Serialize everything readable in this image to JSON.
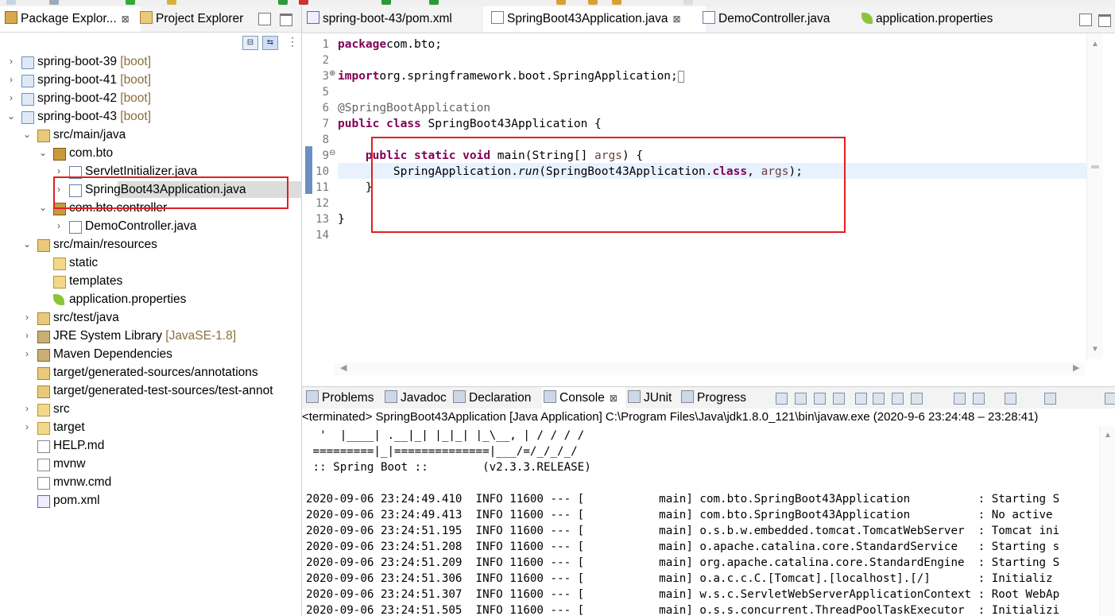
{
  "left_tabs": [
    {
      "label": "Package Explor...",
      "close": "⊠",
      "active": true
    },
    {
      "label": "Project Explorer",
      "active": false
    }
  ],
  "tree": [
    {
      "label": "spring-boot-39",
      "decoration": "[boot]",
      "icon": "maven-project-icon",
      "level": 0,
      "expand": "closed"
    },
    {
      "label": "spring-boot-41",
      "decoration": "[boot]",
      "icon": "maven-project-icon",
      "level": 0,
      "expand": "closed"
    },
    {
      "label": "spring-boot-42",
      "decoration": "[boot]",
      "icon": "maven-project-icon",
      "level": 0,
      "expand": "closed"
    },
    {
      "label": "spring-boot-43",
      "decoration": "[boot]",
      "icon": "maven-project-icon",
      "level": 0,
      "expand": "open"
    },
    {
      "label": "src/main/java",
      "decoration": "",
      "icon": "source-folder-icon",
      "level": 1,
      "expand": "open"
    },
    {
      "label": "com.bto",
      "decoration": "",
      "icon": "package-icon",
      "level": 2,
      "expand": "open"
    },
    {
      "label": "ServletInitializer.java",
      "decoration": "",
      "icon": "java-file-icon",
      "level": 3,
      "expand": "closed"
    },
    {
      "label": "SpringBoot43Application.java",
      "decoration": "",
      "icon": "java-file-icon",
      "level": 3,
      "expand": "closed",
      "selected": true
    },
    {
      "label": "com.bto.controller",
      "decoration": "",
      "icon": "package-icon",
      "level": 2,
      "expand": "open"
    },
    {
      "label": "DemoController.java",
      "decoration": "",
      "icon": "java-file-icon",
      "level": 3,
      "expand": "closed"
    },
    {
      "label": "src/main/resources",
      "decoration": "",
      "icon": "source-folder-icon",
      "level": 1,
      "expand": "open"
    },
    {
      "label": "static",
      "decoration": "",
      "icon": "folder-icon",
      "level": 2,
      "expand": "none"
    },
    {
      "label": "templates",
      "decoration": "",
      "icon": "folder-icon",
      "level": 2,
      "expand": "none"
    },
    {
      "label": "application.properties",
      "decoration": "",
      "icon": "properties-file-icon",
      "level": 2,
      "expand": "none"
    },
    {
      "label": "src/test/java",
      "decoration": "",
      "icon": "source-folder-icon",
      "level": 1,
      "expand": "closed"
    },
    {
      "label": "JRE System Library",
      "decoration": "[JavaSE-1.8]",
      "icon": "library-icon",
      "level": 1,
      "expand": "closed"
    },
    {
      "label": "Maven Dependencies",
      "decoration": "",
      "icon": "library-icon",
      "level": 1,
      "expand": "closed"
    },
    {
      "label": "target/generated-sources/annotations",
      "decoration": "",
      "icon": "source-folder-icon",
      "level": 1,
      "expand": "none"
    },
    {
      "label": "target/generated-test-sources/test-annot",
      "decoration": "",
      "icon": "source-folder-icon",
      "level": 1,
      "expand": "none"
    },
    {
      "label": "src",
      "decoration": "",
      "icon": "folder-icon",
      "level": 1,
      "expand": "closed"
    },
    {
      "label": "target",
      "decoration": "",
      "icon": "folder-icon",
      "level": 1,
      "expand": "closed"
    },
    {
      "label": "HELP.md",
      "decoration": "",
      "icon": "file-icon",
      "level": 1,
      "expand": "none"
    },
    {
      "label": "mvnw",
      "decoration": "",
      "icon": "file-icon",
      "level": 1,
      "expand": "none"
    },
    {
      "label": "mvnw.cmd",
      "decoration": "",
      "icon": "file-icon",
      "level": 1,
      "expand": "none"
    },
    {
      "label": "pom.xml",
      "decoration": "",
      "icon": "maven-file-icon",
      "level": 1,
      "expand": "none"
    }
  ],
  "editor_tabs": [
    {
      "label": "spring-boot-43/pom.xml",
      "icon": "maven-file-icon",
      "active": false,
      "close": ""
    },
    {
      "label": "SpringBoot43Application.java",
      "icon": "java-file-icon",
      "active": true,
      "close": "⊠"
    },
    {
      "label": "DemoController.java",
      "icon": "java-file-icon",
      "active": false,
      "close": ""
    },
    {
      "label": "application.properties",
      "icon": "properties-file-icon",
      "active": false,
      "close": ""
    }
  ],
  "code": [
    {
      "n": "1",
      "tokens": [
        [
          "kw",
          "package"
        ],
        [
          "",
          "com.bto;"
        ]
      ]
    },
    {
      "n": "2",
      "tokens": []
    },
    {
      "n": "3",
      "fold": "⊕",
      "tokens": [
        [
          "kw",
          "import"
        ],
        [
          "",
          "org.springframework.boot.SpringApplication;"
        ],
        [
          "box",
          "□"
        ]
      ]
    },
    {
      "n": "5",
      "tokens": []
    },
    {
      "n": "6",
      "tokens": [
        [
          "ann",
          "@SpringBootApplication"
        ]
      ]
    },
    {
      "n": "7",
      "tokens": [
        [
          "kw",
          "public"
        ],
        [
          "kw",
          " class"
        ],
        [
          "",
          " SpringBoot43Application {"
        ]
      ]
    },
    {
      "n": "8",
      "tokens": []
    },
    {
      "n": "9",
      "fold": "⊖",
      "tokens": [
        [
          "",
          "    "
        ],
        [
          "kw",
          "public"
        ],
        [
          "kw",
          " static"
        ],
        [
          "kw",
          " void"
        ],
        [
          "",
          " main(String[] "
        ],
        [
          "param",
          "args"
        ],
        [
          "",
          ") {"
        ]
      ]
    },
    {
      "n": "10",
      "current": true,
      "tokens": [
        [
          "",
          "        SpringApplication."
        ],
        [
          "it",
          "run"
        ],
        [
          "",
          "(SpringBoot43Application."
        ],
        [
          "kw",
          "class"
        ],
        [
          "",
          ", "
        ],
        [
          "param",
          "args"
        ],
        [
          "",
          ");"
        ]
      ]
    },
    {
      "n": "11",
      "tokens": [
        [
          "",
          "    }"
        ]
      ]
    },
    {
      "n": "12",
      "tokens": []
    },
    {
      "n": "13",
      "tokens": [
        [
          "",
          "}"
        ]
      ]
    },
    {
      "n": "14",
      "tokens": []
    }
  ],
  "console_tabs": [
    {
      "label": "Problems",
      "icon": "problems-icon"
    },
    {
      "label": "Javadoc",
      "icon": "javadoc-icon"
    },
    {
      "label": "Declaration",
      "icon": "declaration-icon"
    },
    {
      "label": "Console",
      "icon": "console-icon",
      "active": true,
      "close": "⊠"
    },
    {
      "label": "JUnit",
      "icon": "junit-icon"
    },
    {
      "label": "Progress",
      "icon": "progress-icon"
    }
  ],
  "console_header": "<terminated> SpringBoot43Application [Java Application] C:\\Program Files\\Java\\jdk1.8.0_121\\bin\\javaw.exe  (2020-9-6 23:24:48 – 23:28:41)",
  "console_lines": [
    "  '  |____| .__|_| |_|_| |_\\__, | / / / /",
    " =========|_|==============|___/=/_/_/_/",
    " :: Spring Boot ::        (v2.3.3.RELEASE)",
    "",
    "2020-09-06 23:24:49.410  INFO 11600 --- [           main] com.bto.SpringBoot43Application          : Starting S",
    "2020-09-06 23:24:49.413  INFO 11600 --- [           main] com.bto.SpringBoot43Application          : No active",
    "2020-09-06 23:24:51.195  INFO 11600 --- [           main] o.s.b.w.embedded.tomcat.TomcatWebServer  : Tomcat ini",
    "2020-09-06 23:24:51.208  INFO 11600 --- [           main] o.apache.catalina.core.StandardService   : Starting s",
    "2020-09-06 23:24:51.209  INFO 11600 --- [           main] org.apache.catalina.core.StandardEngine  : Starting S",
    "2020-09-06 23:24:51.306  INFO 11600 --- [           main] o.a.c.c.C.[Tomcat].[localhost].[/]       : Initializ",
    "2020-09-06 23:24:51.307  INFO 11600 --- [           main] w.s.c.ServletWebServerApplicationContext : Root WebAp",
    "2020-09-06 23:24:51.505  INFO 11600 --- [           main] o.s.s.concurrent.ThreadPoolTaskExecutor  : Initializi"
  ],
  "colors": {
    "highlight_box": "#e02020",
    "keyword": "#7f0055",
    "annotation": "#646464",
    "decoration": "#8a6f3a",
    "current_line": "#e8f2fe"
  }
}
